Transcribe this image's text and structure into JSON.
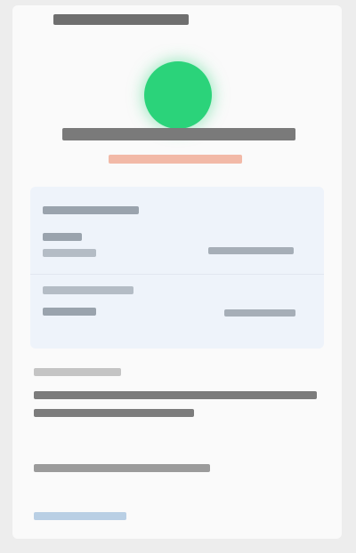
{
  "header": {
    "top_label": ""
  },
  "hero": {
    "icon": "success-check-icon",
    "icon_color": "#2bd37a",
    "title": "",
    "subtitle": "",
    "subtitle_color": "#f2b9a7"
  },
  "summary": {
    "rows": [
      {
        "label": "",
        "value": "",
        "detail": ""
      },
      {
        "label": "",
        "value": ""
      }
    ]
  },
  "footer": {
    "heading": "",
    "paragraph_1": "",
    "paragraph_2": "",
    "link_text": "",
    "link_color": "#b9cfe4"
  },
  "colors": {
    "background": "#ededed",
    "card": "#fafafa",
    "panel": "#eef3fa"
  }
}
